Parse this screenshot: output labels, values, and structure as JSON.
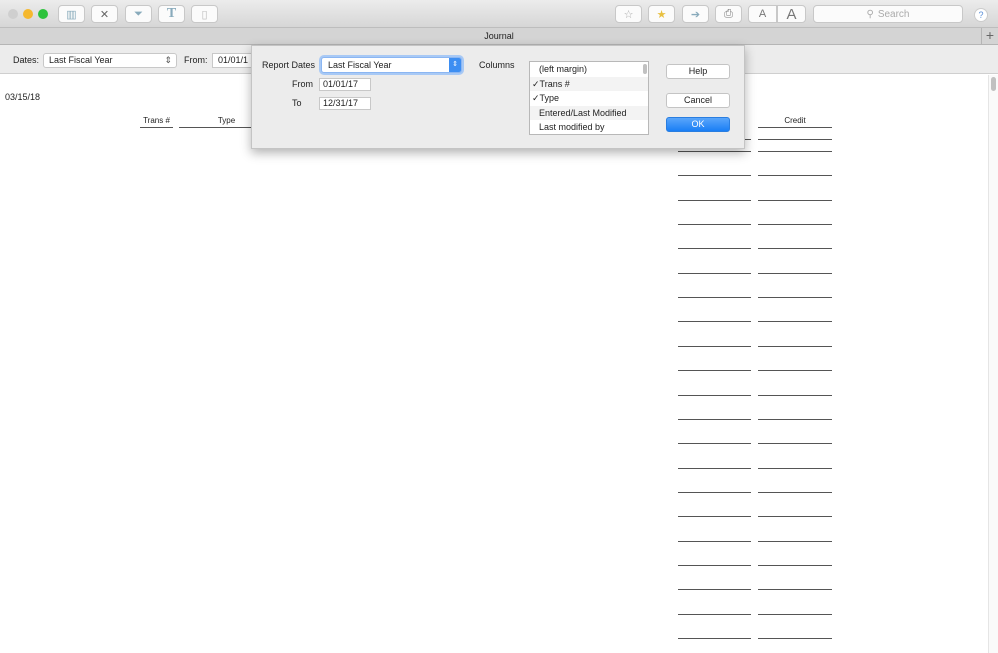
{
  "toolbar": {
    "search_placeholder": "Search",
    "help": "?",
    "font_small": "A",
    "font_large": "A"
  },
  "tab": {
    "title": "Journal",
    "add": "+"
  },
  "filter": {
    "dates_label": "Dates:",
    "dates_value": "Last Fiscal Year",
    "from_label": "From:",
    "from_value": "01/01/1"
  },
  "report": {
    "date": "03/15/18",
    "columns": [
      "Trans #",
      "Type",
      "Credit"
    ],
    "row_count": 21
  },
  "dialog": {
    "report_dates_label": "Report Dates",
    "report_dates_value": "Last Fiscal Year",
    "from_label": "From",
    "from_value": "01/01/17",
    "to_label": "To",
    "to_value": "12/31/17",
    "columns_label": "Columns",
    "columns": [
      "(left margin)",
      "✓Trans #",
      "✓Type",
      "Entered/Last Modified",
      "Last modified by"
    ],
    "help": "Help",
    "cancel": "Cancel",
    "ok": "OK"
  },
  "colors": {
    "accent": "#1a7ef5"
  }
}
